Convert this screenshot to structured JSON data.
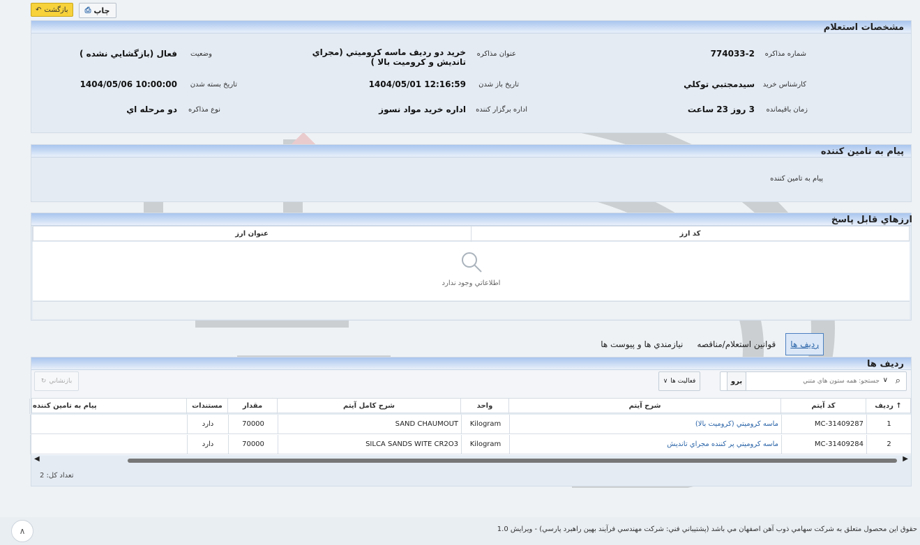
{
  "toolbar": {
    "back_label": "بازگشت",
    "print_label": "چاپ"
  },
  "spec": {
    "title": "مشخصات استعلام",
    "fields": {
      "inquiry_no": {
        "label": "شماره مذاکره",
        "value": "774033-2"
      },
      "inquiry_title": {
        "label": "عنوان مذاکره",
        "value": "خريد دو رديف ماسه كروميتي (مجراي تانديش و كروميت بالا )"
      },
      "status": {
        "label": "وضعيت",
        "value": "فعال (بازگشايي نشده )"
      },
      "buyer": {
        "label": "كارشناس خريد",
        "value": "سيدمجتبي توكلي"
      },
      "open_date": {
        "label": "تاريخ باز شدن",
        "value": "1404/05/01 12:16:59"
      },
      "close_date": {
        "label": "تاريخ بسته شدن",
        "value": "1404/05/06 10:00:00"
      },
      "remaining": {
        "label": "زمان باقيمانده",
        "value": "3 روز 23 ساعت"
      },
      "organizer": {
        "label": "اداره برگزار كننده",
        "value": "اداره خريد مواد نسوز"
      },
      "type": {
        "label": "نوع مذاکره",
        "value": "دو مرحله اي"
      }
    }
  },
  "message": {
    "title": "پيام به تامين كننده",
    "label": "پيام به تامين كننده"
  },
  "currencies": {
    "title": "ارزهاي قابل پاسخ",
    "columns": [
      "كد ارز",
      "عنوان ارز"
    ],
    "empty_text": "اطلاعاتي وجود ندارد"
  },
  "tabs": [
    {
      "label": "رديف ها",
      "active": true
    },
    {
      "label": "قوانين استعلام/مناقصه",
      "active": false
    },
    {
      "label": "نيازمندي ها و پيوست ها",
      "active": false
    }
  ],
  "rows_panel": {
    "title": "رديف ها",
    "search_placeholder": "جستجو: همه ستون هاي متني",
    "go_label": "برو",
    "actions_label": "فعاليت ها",
    "reset_label": "بازنشاني",
    "columns": [
      "رديف",
      "كد آيتم",
      "شرح آيتم",
      "واحد",
      "شرح كامل آيتم",
      "مقدار",
      "مستندات",
      "پيام به تامين كننده"
    ],
    "rows": [
      {
        "no": "1",
        "code": "MC-31409287",
        "desc": "ماسه كروميتي (كروميت بالا)",
        "unit": "Kilogram",
        "full_desc": "SAND CHAUMOUT",
        "qty": "70000",
        "docs": "دارد",
        "msg": ""
      },
      {
        "no": "2",
        "code": "MC-31409284",
        "desc": "ماسه كروميتي پر كننده مجراي تانديش",
        "unit": "Kilogram",
        "full_desc": "SILCA SANDS WITE CR2O3",
        "qty": "70000",
        "docs": "دارد",
        "msg": ""
      }
    ],
    "total_label": "تعداد كل: 2"
  },
  "footer": {
    "text": "حقوق اين محصول متعلق به شركت سهامي ذوب آهن اصفهان مي باشد (پشتيباني فني: شركت مهندسي فرآيند بهين راهبرد پارسي) - ويرايش 1.0"
  },
  "colors": {
    "accent": "#2a64a8",
    "back_button": "#f7d23a",
    "header_band": "#a8c5ee"
  }
}
